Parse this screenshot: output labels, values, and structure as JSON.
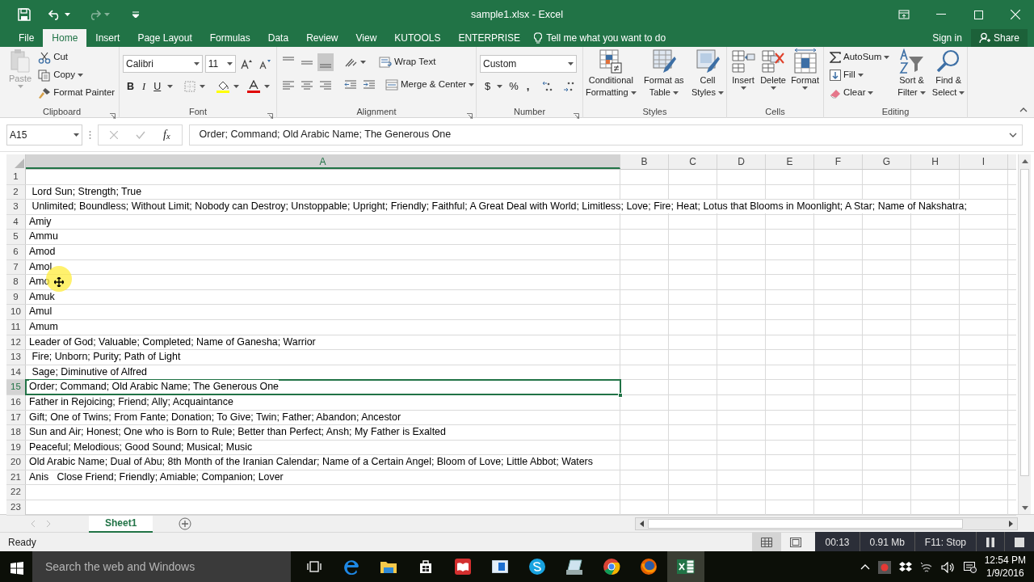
{
  "window": {
    "title": "sample1.xlsx - Excel"
  },
  "ribbon_tabs": [
    {
      "label": "File",
      "selected": false
    },
    {
      "label": "Home",
      "selected": true
    },
    {
      "label": "Insert",
      "selected": false
    },
    {
      "label": "Page Layout",
      "selected": false
    },
    {
      "label": "Formulas",
      "selected": false
    },
    {
      "label": "Data",
      "selected": false
    },
    {
      "label": "Review",
      "selected": false
    },
    {
      "label": "View",
      "selected": false
    },
    {
      "label": "KUTOOLS",
      "selected": false
    },
    {
      "label": "ENTERPRISE",
      "selected": false
    }
  ],
  "tell_me": "Tell me what you want to do",
  "account": {
    "sign_in": "Sign in",
    "share": "Share"
  },
  "clipboard": {
    "label": "Clipboard",
    "paste": "Paste",
    "paste_disabled": true,
    "cut": "Cut",
    "copy": "Copy",
    "format_painter": "Format Painter"
  },
  "font": {
    "label": "Font",
    "name": "Calibri",
    "size": "11",
    "bold": "B",
    "italic": "I",
    "underline": "U"
  },
  "alignment": {
    "label": "Alignment",
    "wrap_text": "Wrap Text",
    "merge_center": "Merge & Center",
    "bottom_align_selected": true
  },
  "number": {
    "label": "Number",
    "format": "Custom",
    "currency": "$",
    "percent": "%",
    "comma": ","
  },
  "styles": {
    "label": "Styles",
    "buttons": [
      [
        "Conditional",
        "Formatting"
      ],
      [
        "Format as",
        "Table"
      ],
      [
        "Cell",
        "Styles"
      ]
    ]
  },
  "cells": {
    "label": "Cells",
    "buttons": [
      "Insert",
      "Delete",
      "Format"
    ]
  },
  "editing": {
    "label": "Editing",
    "autosum": "AutoSum",
    "fill": "Fill",
    "clear": "Clear",
    "sort_filter": [
      "Sort &",
      "Filter"
    ],
    "find_select": [
      "Find &",
      "Select"
    ]
  },
  "formula_bar": {
    "name_box": "A15",
    "fx": "f$_{x}$",
    "formula": "Order; Command; Old Arabic Name; The Generous One"
  },
  "columns": [
    {
      "label": "A",
      "selected": true
    },
    {
      "label": "B",
      "selected": false
    },
    {
      "label": "C",
      "selected": false
    },
    {
      "label": "D",
      "selected": false
    },
    {
      "label": "E",
      "selected": false
    },
    {
      "label": "F",
      "selected": false
    },
    {
      "label": "G",
      "selected": false
    },
    {
      "label": "H",
      "selected": false
    },
    {
      "label": "I",
      "selected": false
    }
  ],
  "rows": [
    {
      "number": "1",
      "selected": false
    },
    {
      "number": "2",
      "text": " Lord Sun; Strength; True",
      "selected": false
    },
    {
      "number": "3",
      "text": " Unlimited; Boundless; Without Limit; Nobody can Destroy; Unstoppable; Upright; Friendly; Faithful; A Great Deal with World; Limitless; Love; Fire; Heat; Lotus that Blooms in Moonlight; A Star; Name of Nakshatra;",
      "selected": false
    },
    {
      "number": "4",
      "text": "Amiy",
      "selected": false
    },
    {
      "number": "5",
      "text": "Ammu",
      "selected": false
    },
    {
      "number": "6",
      "text": "Amod",
      "selected": false
    },
    {
      "number": "7",
      "text": "Amol",
      "selected": false
    },
    {
      "number": "8",
      "text": "Amo",
      "selected": false
    },
    {
      "number": "9",
      "text": "Amuk",
      "selected": false
    },
    {
      "number": "10",
      "text": "Amul",
      "selected": false
    },
    {
      "number": "11",
      "text": "Amum",
      "selected": false
    },
    {
      "number": "12",
      "text": "Leader of God; Valuable; Completed; Name of Ganesha; Warrior",
      "selected": false
    },
    {
      "number": "13",
      "text": " Fire; Unborn; Purity; Path of Light",
      "selected": false
    },
    {
      "number": "14",
      "text": " Sage; Diminutive of Alfred",
      "selected": false
    },
    {
      "number": "15",
      "text": "Order; Command; Old Arabic Name; The Generous One",
      "selected": true
    },
    {
      "number": "16",
      "text": "Father in Rejoicing; Friend; Ally; Acquaintance",
      "selected": false
    },
    {
      "number": "17",
      "text": "Gift; One of Twins; From Fante; Donation; To Give; Twin; Father; Abandon; Ancestor",
      "selected": false
    },
    {
      "number": "18",
      "text": "Sun and Air; Honest; One who is Born to Rule; Better than Perfect; Ansh; My Father is Exalted",
      "selected": false
    },
    {
      "number": "19",
      "text": "Peaceful; Melodious; Good Sound; Musical; Music",
      "selected": false
    },
    {
      "number": "20",
      "text": "Old Arabic Name; Dual of Abu; 8th Month of the Iranian Calendar; Name of a Certain Angel; Bloom of Love; Little Abbot; Waters",
      "selected": false
    },
    {
      "number": "21",
      "text": "Anis   Close Friend; Friendly; Amiable; Companion; Lover",
      "selected": false
    },
    {
      "number": "22",
      "selected": false
    },
    {
      "number": "23",
      "selected": false
    }
  ],
  "sheet_tabs": [
    {
      "label": "Sheet1",
      "selected": true
    }
  ],
  "status": "Ready",
  "view_buttons": [
    {
      "kind": "normal",
      "selected": true
    },
    {
      "kind": "page",
      "selected": false
    }
  ],
  "recorder": {
    "time": "00:13",
    "size": "0.91 Mb",
    "hotkey": "F11: Stop"
  },
  "taskbar": {
    "search_placeholder": "Search the web and Windows",
    "time": "12:54 PM",
    "date": "1/9/2016"
  }
}
